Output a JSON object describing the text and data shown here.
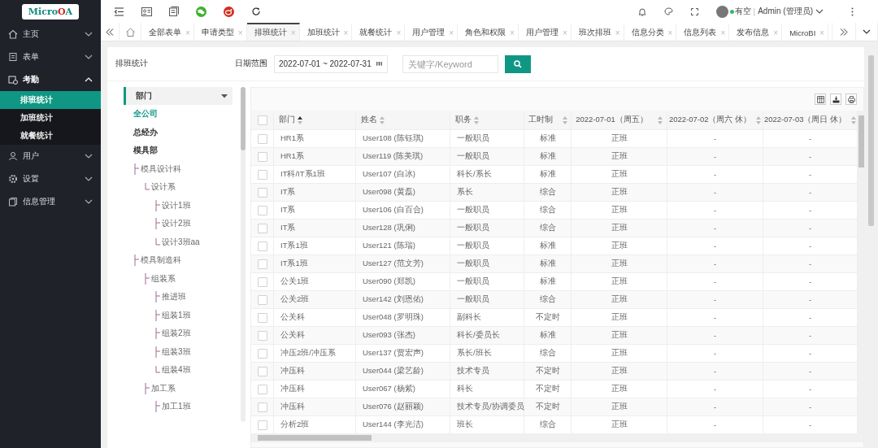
{
  "logo": {
    "parts": [
      {
        "text": "Micro",
        "color": "#0f8c7c"
      },
      {
        "text": "O",
        "color": "#d6221c"
      },
      {
        "text": "A",
        "color": "#0f8c7c"
      }
    ]
  },
  "sidebar": {
    "items": [
      {
        "label": "主页",
        "expanded": false
      },
      {
        "label": "表单",
        "expanded": false
      },
      {
        "label": "考勤",
        "expanded": true,
        "children": [
          {
            "label": "排班统计",
            "selected": true
          },
          {
            "label": "加班统计",
            "selected": false
          },
          {
            "label": "就餐统计",
            "selected": false
          }
        ]
      },
      {
        "label": "用户",
        "expanded": false
      },
      {
        "label": "设置",
        "expanded": false
      },
      {
        "label": "信息管理",
        "expanded": false
      }
    ]
  },
  "user": {
    "status": "有空",
    "separator": "|",
    "name": "Admin (管理员)"
  },
  "tabs": [
    {
      "label": "全部表单",
      "selected": false
    },
    {
      "label": "申请类型",
      "selected": false
    },
    {
      "label": "排班统计",
      "selected": true
    },
    {
      "label": "加班统计",
      "selected": false
    },
    {
      "label": "就餐统计",
      "selected": false
    },
    {
      "label": "用户管理",
      "selected": false
    },
    {
      "label": "角色和权限",
      "selected": false
    },
    {
      "label": "用户管理",
      "selected": false
    },
    {
      "label": "班次排班",
      "selected": false
    },
    {
      "label": "信息分类",
      "selected": false
    },
    {
      "label": "信息列表",
      "selected": false
    },
    {
      "label": "发布信息",
      "selected": false
    },
    {
      "label": "MicroBI",
      "selected": false
    }
  ],
  "tab_close": "×",
  "page": {
    "title": "排班统计",
    "date_label": "日期范围",
    "date_value": "2022-07-01 ~ 2022-07-31",
    "search": {
      "placeholder": "关键字/Keyword"
    }
  },
  "tree": {
    "header": "部门",
    "nodes": [
      {
        "label": "全公司",
        "selected": true
      },
      {
        "label": "总经办",
        "selected": false
      },
      {
        "label": "模具部",
        "selected": false,
        "children": [
          {
            "label": "模具设计科",
            "selected": false,
            "last_child": false,
            "children": [
              {
                "label": "设计系",
                "selected": false,
                "last_child": true,
                "children": [
                  {
                    "label": "设计1班",
                    "selected": false,
                    "last_child": false
                  },
                  {
                    "label": "设计2班",
                    "selected": false,
                    "last_child": false
                  },
                  {
                    "label": "设计3班aa",
                    "selected": false,
                    "last_child": true
                  }
                ]
              }
            ]
          },
          {
            "label": "模具制造科",
            "selected": false,
            "last_child": false,
            "children": [
              {
                "label": "组装系",
                "selected": false,
                "last_child": false,
                "children": [
                  {
                    "label": "推进班",
                    "selected": false,
                    "last_child": false
                  },
                  {
                    "label": "组装1班",
                    "selected": false,
                    "last_child": false
                  },
                  {
                    "label": "组装2班",
                    "selected": false,
                    "last_child": false
                  },
                  {
                    "label": "组装3班",
                    "selected": false,
                    "last_child": false
                  },
                  {
                    "label": "组装4班",
                    "selected": false,
                    "last_child": true
                  }
                ]
              },
              {
                "label": "加工系",
                "selected": false,
                "last_child": false,
                "children": [
                  {
                    "label": "加工1班",
                    "selected": false,
                    "last_child": false
                  }
                ]
              }
            ]
          }
        ]
      }
    ]
  },
  "table": {
    "select_all": {
      "checked": false
    },
    "columns": [
      {
        "label": "部门",
        "sorted": true
      },
      {
        "label": "姓名",
        "sorted": false
      },
      {
        "label": "职务",
        "sorted": false
      },
      {
        "label": "工时制",
        "sorted": false
      },
      {
        "label": "2022-07-01（周五）",
        "sorted": false
      },
      {
        "label": "2022-07-02（周六 休）",
        "sorted": false
      },
      {
        "label": "2022-07-03（周日 休）",
        "sorted": false
      }
    ],
    "rows": [
      {
        "checked": false,
        "cells": [
          "HR1系",
          "User108 (陈钰琪)",
          "一般职员",
          "标准",
          "正班",
          "-",
          "-"
        ]
      },
      {
        "checked": false,
        "cells": [
          "HR1系",
          "User119 (陈美琪)",
          "一般职员",
          "标准",
          "正班",
          "-",
          "-"
        ]
      },
      {
        "checked": false,
        "cells": [
          "IT科/IT系1班",
          "User107 (白冰)",
          "科长/系长",
          "标准",
          "正班",
          "-",
          "-"
        ]
      },
      {
        "checked": false,
        "cells": [
          "IT系",
          "User098 (黄磊)",
          "系长",
          "综合",
          "正班",
          "-",
          "-"
        ]
      },
      {
        "checked": false,
        "cells": [
          "IT系",
          "User106 (白百合)",
          "一般职员",
          "综合",
          "正班",
          "-",
          "-"
        ]
      },
      {
        "checked": false,
        "cells": [
          "IT系",
          "User128 (巩俐)",
          "一般职员",
          "综合",
          "正班",
          "-",
          "-"
        ]
      },
      {
        "checked": false,
        "cells": [
          "IT系1班",
          "User121 (陈瑞)",
          "一般职员",
          "标准",
          "正班",
          "-",
          "-"
        ]
      },
      {
        "checked": false,
        "cells": [
          "IT系1班",
          "User127 (范文芳)",
          "一般职员",
          "标准",
          "正班",
          "-",
          "-"
        ]
      },
      {
        "checked": false,
        "cells": [
          "公关1班",
          "User090 (郑凯)",
          "一般职员",
          "标准",
          "正班",
          "-",
          "-"
        ]
      },
      {
        "checked": false,
        "cells": [
          "公关2班",
          "User142 (刘恩佑)",
          "一般职员",
          "综合",
          "正班",
          "-",
          "-"
        ]
      },
      {
        "checked": false,
        "cells": [
          "公关科",
          "User048 (罗明珠)",
          "副科长",
          "不定时",
          "正班",
          "-",
          "-"
        ]
      },
      {
        "checked": false,
        "cells": [
          "公关科",
          "User093 (张杰)",
          "科长/委员长",
          "标准",
          "正班",
          "-",
          "-"
        ]
      },
      {
        "checked": false,
        "cells": [
          "冲压2班/冲压系",
          "User137 (贾宏声)",
          "系长/班长",
          "综合",
          "正班",
          "-",
          "-"
        ]
      },
      {
        "checked": false,
        "cells": [
          "冲压科",
          "User044 (梁艺龄)",
          "技术专员",
          "不定时",
          "正班",
          "-",
          "-"
        ]
      },
      {
        "checked": false,
        "cells": [
          "冲压科",
          "User067 (杨紫)",
          "科长",
          "不定时",
          "正班",
          "-",
          "-"
        ]
      },
      {
        "checked": false,
        "cells": [
          "冲压科",
          "User076 (赵丽颖)",
          "技术专员/协调委员",
          "不定时",
          "正班",
          "-",
          "-"
        ]
      },
      {
        "checked": false,
        "cells": [
          "分析2班",
          "User144 (李光洁)",
          "班长",
          "综合",
          "正班",
          "-",
          "-"
        ]
      }
    ]
  }
}
